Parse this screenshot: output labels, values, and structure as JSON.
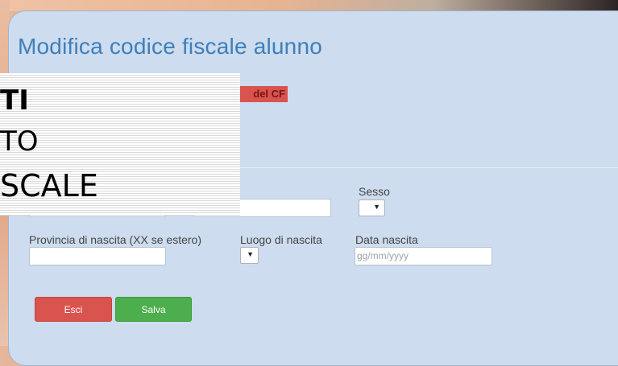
{
  "form": {
    "title": "Modifica codice fiscale alunno",
    "alert_text": "del CF",
    "labels": {
      "sex": "Sesso",
      "province": "Provincia di nascita (XX se estero)",
      "birthplace": "Luogo di nascita",
      "birthdate": "Data nascita"
    },
    "birthdate_placeholder": "gg/mm/yyyy",
    "buttons": {
      "exit": "Esci",
      "save": "Salva"
    }
  },
  "overlay": {
    "lines": [
      "TI",
      "TO",
      "SCALE"
    ]
  },
  "colors": {
    "panel": "#cddcee",
    "title": "#3f7fbb",
    "alert": "#d9534f",
    "exit_button": "#d9534f",
    "save_button": "#4cae4c"
  }
}
